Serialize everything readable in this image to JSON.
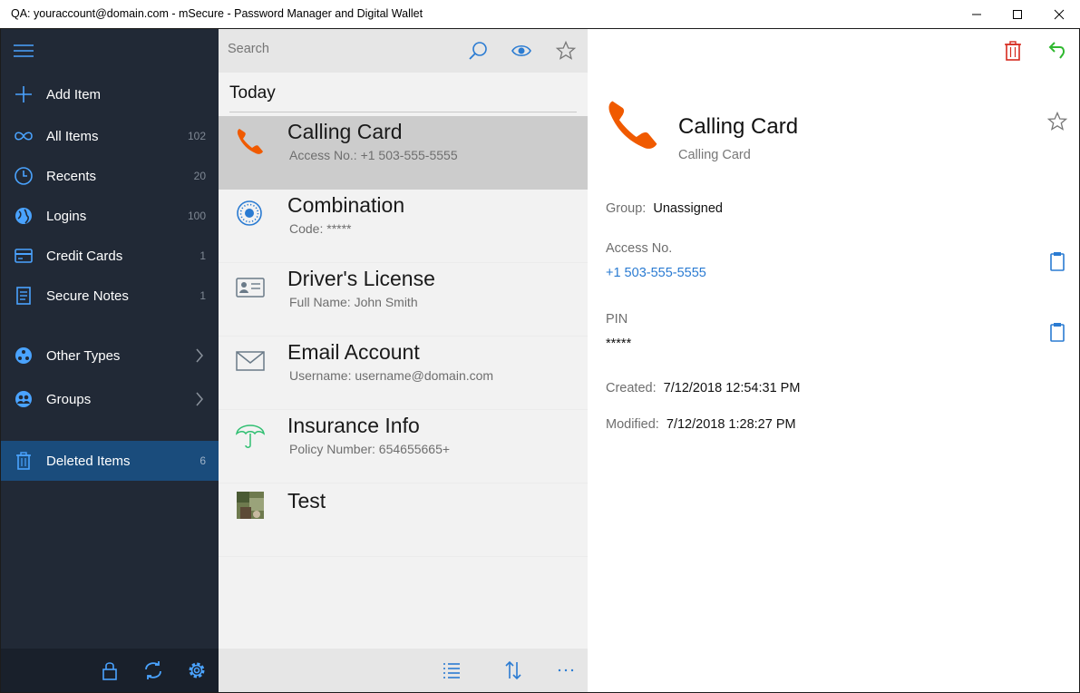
{
  "window": {
    "title": "QA: youraccount@domain.com - mSecure - Password Manager and Digital Wallet"
  },
  "sidebar": {
    "items": [
      {
        "label": "Add Item",
        "count": "",
        "icon": "plus-icon"
      },
      {
        "label": "All Items",
        "count": "102",
        "icon": "infinity-icon"
      },
      {
        "label": "Recents",
        "count": "20",
        "icon": "clock-icon"
      },
      {
        "label": "Logins",
        "count": "100",
        "icon": "globe-icon"
      },
      {
        "label": "Credit Cards",
        "count": "1",
        "icon": "credit-card-icon"
      },
      {
        "label": "Secure Notes",
        "count": "1",
        "icon": "note-icon"
      },
      {
        "label": "Other Types",
        "count": "",
        "icon": "other-types-icon"
      },
      {
        "label": "Groups",
        "count": "",
        "icon": "groups-icon"
      },
      {
        "label": "Deleted Items",
        "count": "6",
        "icon": "trash-icon"
      }
    ],
    "footer": [
      "lock-icon",
      "sync-icon",
      "settings-icon"
    ]
  },
  "list": {
    "search_placeholder": "Search",
    "section": "Today",
    "items": [
      {
        "title": "Calling Card",
        "subtitle": "Access No.: +1 503-555-5555",
        "icon": "phone-icon"
      },
      {
        "title": "Combination",
        "subtitle": "Code: *****",
        "icon": "combination-lock-icon"
      },
      {
        "title": "Driver's License",
        "subtitle": "Full Name: John Smith",
        "icon": "id-card-icon"
      },
      {
        "title": "Email Account",
        "subtitle": "Username: username@domain.com",
        "icon": "envelope-icon"
      },
      {
        "title": "Insurance Info",
        "subtitle": "Policy Number: 654655665+",
        "icon": "umbrella-icon"
      },
      {
        "title": "Test",
        "subtitle": "",
        "icon": "photo-thumbnail-icon"
      }
    ]
  },
  "detail": {
    "name": "Calling Card",
    "type": "Calling Card",
    "group_label": "Group:",
    "group_value": "Unassigned",
    "access_label": "Access No.",
    "access_value": "+1 503-555-5555",
    "pin_label": "PIN",
    "pin_value": "*****",
    "created_label": "Created:",
    "created_value": "7/12/2018 12:54:31 PM",
    "modified_label": "Modified:",
    "modified_value": "7/12/2018 1:28:27 PM"
  },
  "colors": {
    "sidebar_bg": "#212936",
    "active_bg": "#1a4c7c",
    "accent_blue": "#2a7bd2",
    "phone_orange": "#f05a00",
    "delete_red": "#d62a1e",
    "undo_green": "#2fb82f"
  }
}
